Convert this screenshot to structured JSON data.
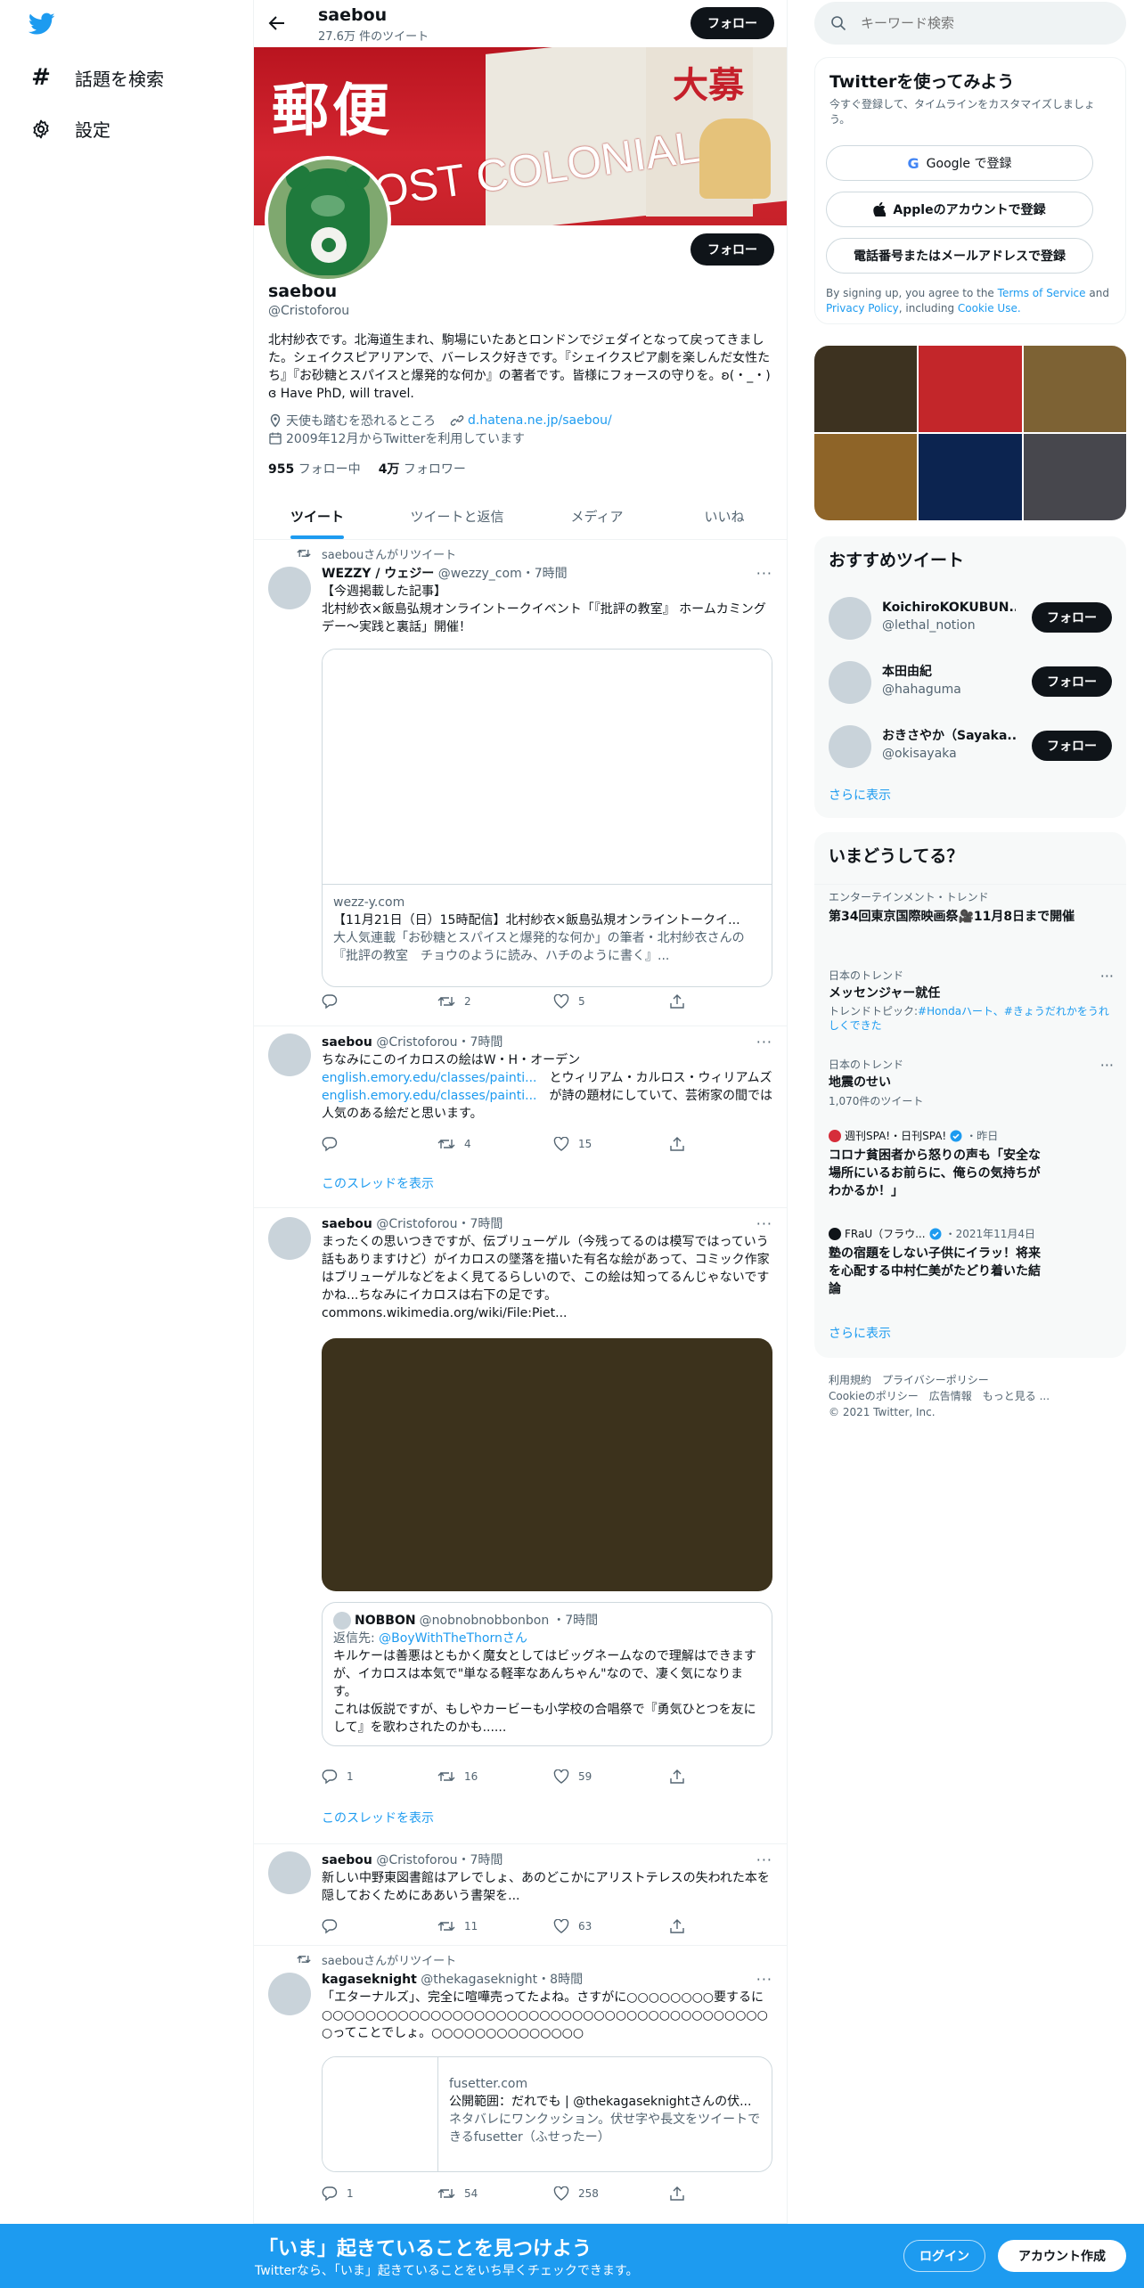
{
  "nav": {
    "explore": "話題を検索",
    "settings": "設定"
  },
  "header": {
    "name": "saebou",
    "tweet_count": "27.6万 件のツイート",
    "follow": "フォロー"
  },
  "banner": {
    "text_post": "郵便",
    "text_colonial": "POST COLONIAL",
    "text_top": "大募"
  },
  "profile": {
    "name": "saebou",
    "handle": "@Cristoforou",
    "follow": "フォロー",
    "bio": "北村紗衣です。北海道生まれ、駒場にいたあとロンドンでジェダイとなって戻ってきました。シェイクスピアリアンで、バーレスク好きです。『シェイクスピア劇を楽しんだ女性たち』『お砂糖とスパイスと爆発的な何か』の著者です。皆様にフォースの守りを。ʚ(・_・)ɞ Have PhD, will travel.",
    "location": "天使も踏むを恐れるところ",
    "link": "d.hatena.ne.jp/saebou/",
    "joined": "2009年12月からTwitterを利用しています",
    "following_count": "955",
    "following_label": "フォロー中",
    "followers_count": "4万",
    "followers_label": "フォロワー"
  },
  "tabs": [
    "ツイート",
    "ツイートと返信",
    "メディア",
    "いいね"
  ],
  "tweets": [
    {
      "retweet_label": "saebouさんがリツイート",
      "name": "WEZZY / ウェジー",
      "handle": "@wezzy_com",
      "time": "・7時間",
      "text": "【今週掲載した記事】\n北村紗衣×飯島弘規オンライントークイベント「『批評の教室』 ホームカミングデー～実践と裏話」開催！",
      "card_domain": "wezz-y.com",
      "card_title": "【11月21日（日）15時配信】北村紗衣×飯島弘規オンライントークイ...",
      "card_desc": "大人気連載「お砂糖とスパイスと爆発的な何か」の筆者・北村紗衣さんの『批評の教室　チョウのように読み、ハチのように書く』...",
      "replies": "",
      "retweets": "2",
      "likes": "5"
    },
    {
      "name": "saebou",
      "handle": "@Cristoforou",
      "time": "・7時間",
      "text1": "ちなみにこのイカロスの絵はW・H・オーデン",
      "link1": "english.emory.edu/classes/painti...",
      "text2": "とウィリアム・カルロス・ウィリアムズ",
      "link2": "english.emory.edu/classes/painti...",
      "text3": "が詩の題材にしていて、芸術家の間では人気のある絵だと思います。",
      "replies": "",
      "retweets": "4",
      "likes": "15",
      "thread": "このスレッドを表示"
    },
    {
      "name": "saebou",
      "handle": "@Cristoforou",
      "time": "・7時間",
      "text": "まったくの思いつきですが、伝ブリューゲル（今残ってるのは模写ではっていう話もありますけど）がイカロスの墜落を描いた有名な絵があって、コミック作家はブリューゲルなどをよく見てるらしいので、この絵は知ってるんじゃないですかね...ちなみにイカロスは右下の足です。",
      "link": "commons.wikimedia.org/wiki/File:Piet...",
      "quote_name": "NOBBON",
      "quote_handle": "@nobnobnobbonbon",
      "quote_time": "・7時間",
      "quote_reply_label": "返信先:",
      "quote_reply_to": "@BoyWithTheThornさん",
      "quote_text": "キルケーは善悪はともかく魔女としてはビッグネームなので理解はできますが、イカロスは本気で\"単なる軽率なあんちゃん\"なので、凄く気になります。\nこれは仮説ですが、もしやカービーも小学校の合唱祭で『勇気ひとつを友にして』を歌わされたのかも......",
      "replies": "1",
      "retweets": "16",
      "likes": "59",
      "thread": "このスレッドを表示"
    },
    {
      "name": "saebou",
      "handle": "@Cristoforou",
      "time": "・7時間",
      "text": "新しい中野東図書館はアレでしょ、あのどこかにアリストテレスの失われた本を隠しておくためにああいう書架を...",
      "replies": "",
      "retweets": "11",
      "likes": "63"
    },
    {
      "retweet_label": "saebouさんがリツイート",
      "name": "kagaseknight",
      "handle": "@thekagaseknight",
      "time": "・8時間",
      "text": "「エターナルズ」、完全に喧嘩売ってたよね。さすがに○○○○○○○○要するに○○○○○○○○○○○○○○○○○○○○○○○○○○○○○○○○○○○○○○○○○○ってことでしょ。○○○○○○○○○○○○○○",
      "card_domain": "fusetter.com",
      "card_title": "公開範囲：だれでも | @thekagaseknightさんの伏...",
      "card_desc": "ネタバレにワンクッション。伏せ字や長文をツイートできるfusetter（ふせったー）",
      "replies": "1",
      "retweets": "54",
      "likes": "258"
    }
  ],
  "search": {
    "placeholder": "キーワード検索"
  },
  "signup": {
    "title": "Twitterを使ってみよう",
    "subtitle": "今すぐ登録して、タイムラインをカスタマイズしましょう。",
    "google": "Google で登録",
    "apple": "Appleのアカウントで登録",
    "phone": "電話番号またはメールアドレスで登録",
    "terms_prefix": "By signing up, you agree to the",
    "terms": "Terms of Service",
    "and": "and",
    "privacy": "Privacy Policy",
    "including": ", including",
    "cookie": "Cookie Use."
  },
  "media_grid_colors": [
    "#3d3220",
    "#c3262a",
    "#7d6234",
    "#8e6428",
    "#0c2450",
    "#47474d"
  ],
  "suggested": {
    "title": "おすすめツイート",
    "users": [
      {
        "name": "KoichiroKOKUBUN...",
        "handle": "@lethal_notion",
        "follow": "フォロー"
      },
      {
        "name": "本田由紀",
        "handle": "@hahaguma",
        "follow": "フォロー"
      },
      {
        "name": "おきさやか（Sayaka...",
        "handle": "@okisayaka",
        "follow": "フォロー"
      }
    ],
    "more": "さらに表示"
  },
  "trends": {
    "title": "いまどうしてる？",
    "items": [
      {
        "category": "エンターテインメント・トレンド",
        "title": "第34回東京国際映画祭🎥11月8日まで開催"
      },
      {
        "category": "日本のトレンド",
        "title": "メッセンジャー就任",
        "topic_label": "トレンドトピック:",
        "topic": "#Hondaハート、#きょうだれかをうれしくできた"
      },
      {
        "category": "日本のトレンド",
        "title": "地震のせい",
        "count": "1,070件のツイート"
      },
      {
        "source": "週刊SPA!・日刊SPA!",
        "time": "・昨日",
        "title": "コロナ貧困者から怒りの声も「安全な場所にいるお前らに、俺らの気持ちがわかるか！」"
      },
      {
        "source": "FRaU（フラウ...",
        "time": "・2021年11月4日",
        "title": "塾の宿題をしない子供にイラッ！将来を心配する中村仁美がたどり着いた結論"
      }
    ],
    "more": "さらに表示"
  },
  "footer": {
    "terms": "利用規約",
    "privacy": "プライバシーポリシー",
    "cookie": "Cookieのポリシー",
    "ads": "広告情報",
    "more": "もっと見る ...",
    "copyright": "© 2021 Twitter, Inc."
  },
  "bottom": {
    "title": "「いま」起きていることを見つけよう",
    "subtitle": "Twitterなら、「いま」起きていることをいち早くチェックできます。",
    "login": "ログイン",
    "signup": "アカウント作成"
  }
}
